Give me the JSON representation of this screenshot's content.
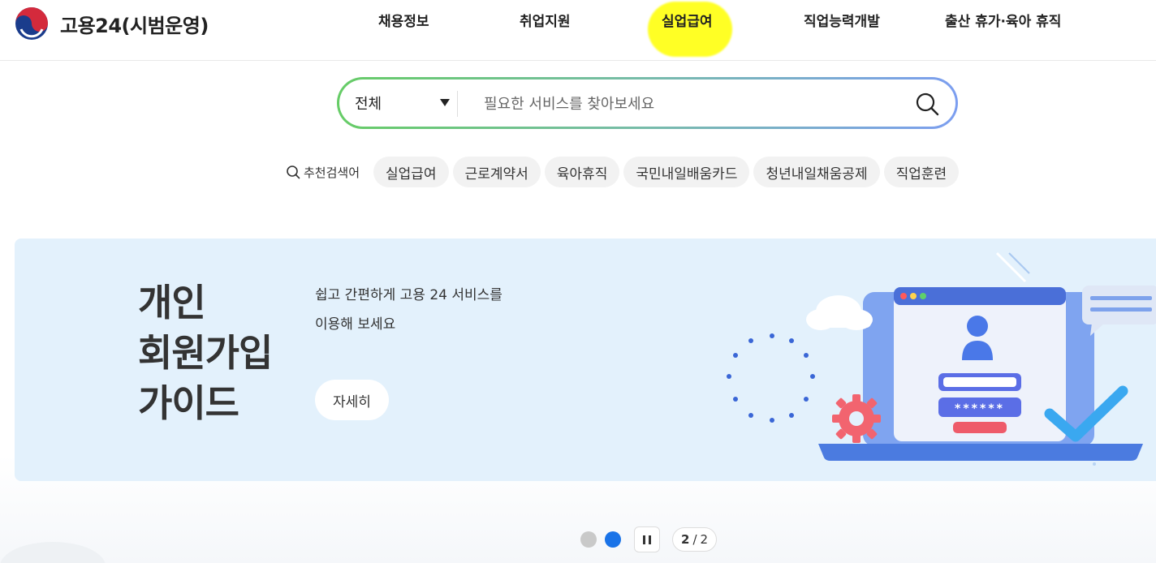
{
  "header": {
    "logo_text": "고용24(시범운영)",
    "nav": [
      {
        "label": "채용정보"
      },
      {
        "label": "취업지원"
      },
      {
        "label": "실업급여"
      },
      {
        "label": "직업능력개발"
      },
      {
        "label": "출산 휴가·육아 휴직"
      }
    ]
  },
  "search": {
    "category": "전체",
    "placeholder": "필요한 서비스를 찾아보세요"
  },
  "recommended": {
    "label": "추천검색어",
    "keywords": [
      "실업급여",
      "근로계약서",
      "육아휴직",
      "국민내일배움카드",
      "청년내일채움공제",
      "직업훈련"
    ]
  },
  "banner": {
    "title_lines": [
      "개인",
      "회원가입",
      "가이드"
    ],
    "desc_lines": [
      "쉽고 간편하게 고용 24 서비스를",
      "이용해 보세요"
    ],
    "button": "자세히",
    "password_mask": "******"
  },
  "pagination": {
    "current": "2",
    "separator": "/",
    "total": "2"
  },
  "colors": {
    "banner_bg": "#e3f1fc",
    "active_dot": "#1a73e8",
    "highlight": "#ffff00",
    "search_gradient_start": "#66cc66",
    "search_gradient_end": "#7c9ef0"
  }
}
